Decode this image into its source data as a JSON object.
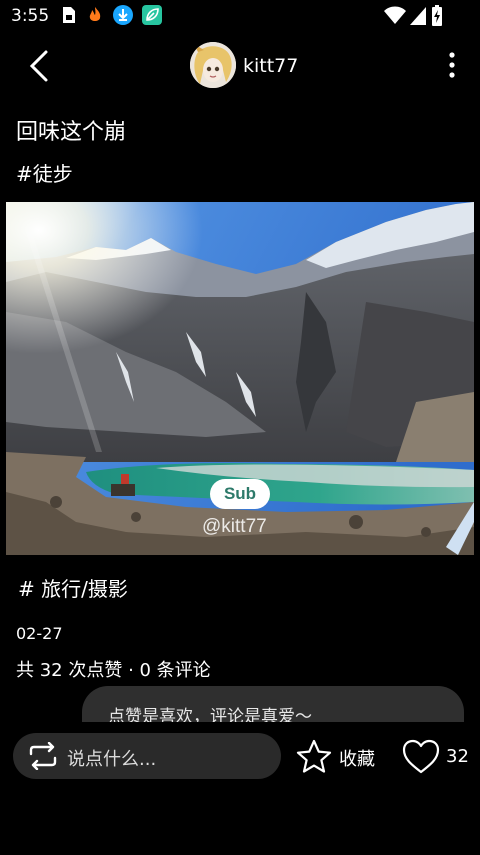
{
  "status_bar": {
    "time": "3:55",
    "left_icons": [
      "sim-card-icon",
      "fire-icon",
      "download-app-icon",
      "leaf-app-icon"
    ],
    "right_icons": [
      "wifi-icon",
      "signal-icon",
      "battery-charging-icon"
    ]
  },
  "header": {
    "username": "kitt77",
    "back_icon": "chevron-left-icon",
    "more_icon": "more-vertical-icon"
  },
  "post": {
    "title": "回味这个崩",
    "tag": "#徒步",
    "image_badge": "Sub",
    "image_watermark": "@kitt77",
    "category": "# 旅行/摄影",
    "date": "02-27",
    "stats": "共 32 次点赞 · 0 条评论"
  },
  "hint": {
    "text": "点赞是喜欢，评论是真爱～"
  },
  "bottom_bar": {
    "comment_placeholder": "说点什么...",
    "favorite_label": "收藏",
    "like_count": "32"
  },
  "colors": {
    "background": "#000000",
    "input_bg": "#2a2a2a",
    "bubble_bg": "#2f2f2f",
    "badge_text": "#2d7a6a"
  }
}
